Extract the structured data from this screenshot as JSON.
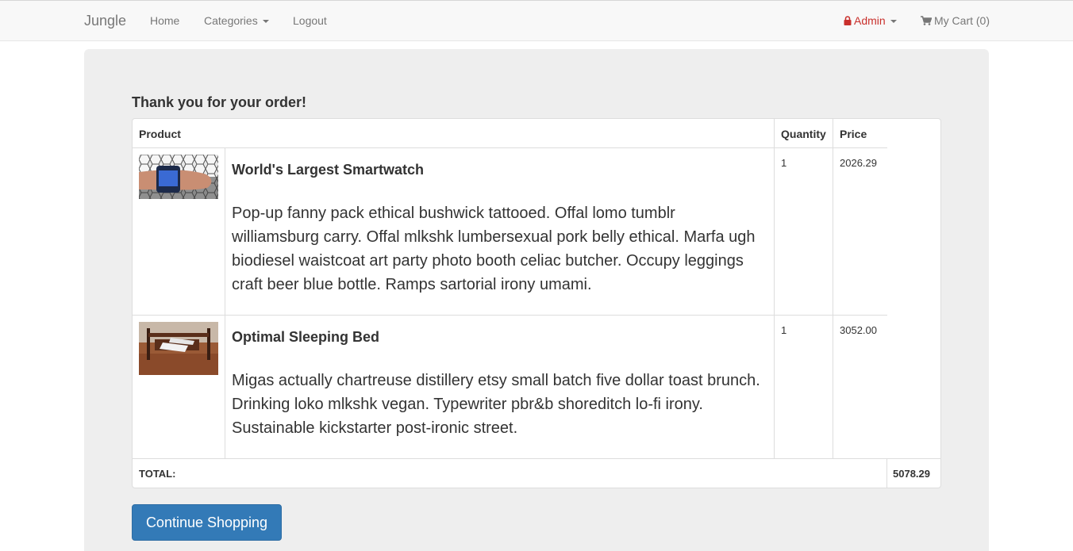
{
  "navbar": {
    "brand": "Jungle",
    "home": "Home",
    "categories": "Categories",
    "logout": "Logout",
    "admin": "Admin",
    "cart": "My Cart (0)"
  },
  "page": {
    "heading": "Thank you for your order!"
  },
  "table": {
    "headers": {
      "product": "Product",
      "quantity": "Quantity",
      "price": "Price"
    },
    "rows": [
      {
        "name": "World's Largest Smartwatch",
        "description": "Pop-up fanny pack ethical bushwick tattooed. Offal lomo tumblr williamsburg carry. Offal mlkshk lumbersexual pork belly ethical. Marfa ugh biodiesel waistcoat art party photo booth celiac butcher. Occupy leggings craft beer blue bottle. Ramps sartorial irony umami.",
        "quantity": "1",
        "price": "2026.29"
      },
      {
        "name": "Optimal Sleeping Bed",
        "description": "Migas actually chartreuse distillery etsy small batch five dollar toast brunch. Drinking loko mlkshk vegan. Typewriter pbr&b shoreditch lo-fi irony. Sustainable kickstarter post-ironic street.",
        "quantity": "1",
        "price": "3052.00"
      }
    ],
    "total_label": "TOTAL:",
    "total_value": "5078.29"
  },
  "actions": {
    "continue_shopping": "Continue Shopping"
  },
  "colors": {
    "primary": "#337ab7",
    "admin": "#c9302c"
  }
}
